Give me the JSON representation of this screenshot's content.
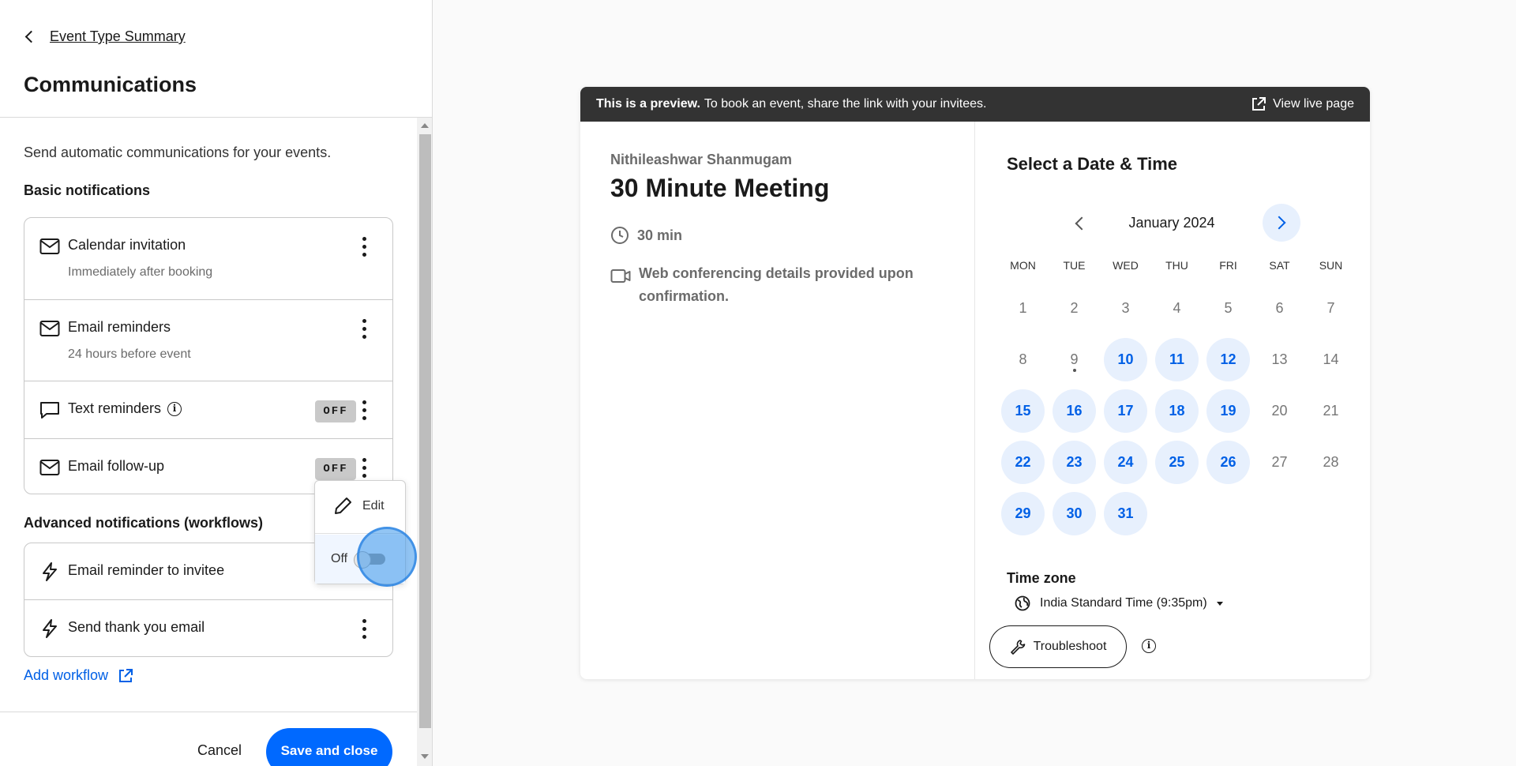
{
  "left_panel": {
    "back_label": "Event Type Summary",
    "title": "Communications",
    "intro": "Send automatic communications for your events.",
    "basic_title": "Basic notifications",
    "basic_items": [
      {
        "label": "Calendar invitation",
        "sub": "Immediately after booking",
        "icon": "mail-icon"
      },
      {
        "label": "Email reminders",
        "sub": "24 hours before event",
        "icon": "mail-icon"
      },
      {
        "label": "Text reminders",
        "status": "OFF",
        "icon": "chat-icon"
      },
      {
        "label": "Email follow-up",
        "status": "OFF",
        "icon": "mail-icon"
      }
    ],
    "info_glyph": "i",
    "advanced_title": "Advanced notifications (workflows)",
    "advanced_items": [
      {
        "label": "Email reminder to invitee",
        "icon": "lightning-icon"
      },
      {
        "label": "Send thank you email",
        "icon": "lightning-icon"
      }
    ],
    "add_workflow": "Add workflow",
    "cancel": "Cancel",
    "save": "Save and close"
  },
  "popover": {
    "edit": "Edit",
    "off": "Off"
  },
  "preview": {
    "banner_bold": "This is a preview.",
    "banner_text": "To book an event, share the link with your invitees.",
    "view_live": "View live page",
    "host": "Nithileashwar Shanmugam",
    "event_title": "30 Minute Meeting",
    "duration": "30 min",
    "conferencing": "Web conferencing details provided upon confirmation.",
    "select_title": "Select a Date & Time",
    "month": "January 2024",
    "weekdays": [
      "MON",
      "TUE",
      "WED",
      "THU",
      "FRI",
      "SAT",
      "SUN"
    ],
    "days": [
      {
        "d": "1"
      },
      {
        "d": "2"
      },
      {
        "d": "3"
      },
      {
        "d": "4"
      },
      {
        "d": "5"
      },
      {
        "d": "6"
      },
      {
        "d": "7"
      },
      {
        "d": "8"
      },
      {
        "d": "9",
        "today": true
      },
      {
        "d": "10",
        "avail": true
      },
      {
        "d": "11",
        "avail": true
      },
      {
        "d": "12",
        "avail": true
      },
      {
        "d": "13"
      },
      {
        "d": "14"
      },
      {
        "d": "15",
        "avail": true
      },
      {
        "d": "16",
        "avail": true
      },
      {
        "d": "17",
        "avail": true
      },
      {
        "d": "18",
        "avail": true
      },
      {
        "d": "19",
        "avail": true
      },
      {
        "d": "20"
      },
      {
        "d": "21"
      },
      {
        "d": "22",
        "avail": true
      },
      {
        "d": "23",
        "avail": true
      },
      {
        "d": "24",
        "avail": true
      },
      {
        "d": "25",
        "avail": true
      },
      {
        "d": "26",
        "avail": true
      },
      {
        "d": "27"
      },
      {
        "d": "28"
      },
      {
        "d": "29",
        "avail": true
      },
      {
        "d": "30",
        "avail": true
      },
      {
        "d": "31",
        "avail": true
      }
    ],
    "timezone_title": "Time zone",
    "timezone": "India Standard Time (9:35pm)",
    "troubleshoot": "Troubleshoot"
  },
  "colors": {
    "accent": "#0069ff",
    "link": "#0060e6",
    "available_bg": "#e7f0fd",
    "banner_bg": "#333333"
  }
}
